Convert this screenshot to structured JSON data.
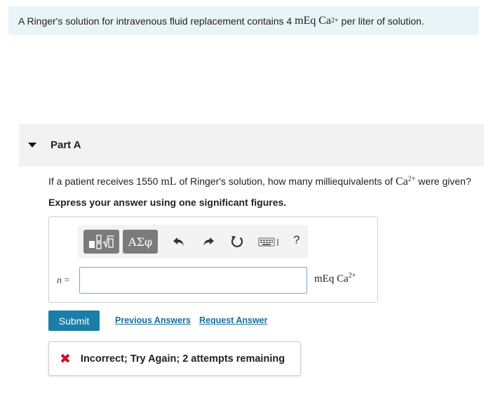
{
  "intro": {
    "text_before": "A Ringer's solution for intravenous fluid replacement contains 4",
    "amount_unit": "mEq",
    "ion": "Ca",
    "charge": "2+",
    "text_after": "per liter of solution."
  },
  "part": {
    "title": "Part A"
  },
  "question": {
    "text_before": "If a patient receives 1550",
    "volume_unit": "mL",
    "text_middle": "of Ringer's solution, how many milliequivalents of",
    "ion": "Ca",
    "charge": "2+",
    "text_after": "were given?",
    "instruction": "Express your answer using one significant figures."
  },
  "toolbar": {
    "templates_icon": "fraction-sqrt-template-icon",
    "greek_label": "ΑΣφ",
    "undo_icon": "undo-icon",
    "redo_icon": "redo-icon",
    "reset_icon": "reset-icon",
    "keyboard_icon": "keyboard-icon",
    "help_label": "?"
  },
  "answer": {
    "variable": "n",
    "equals": "=",
    "value": "",
    "units_amount": "mEq",
    "units_ion": "Ca",
    "units_charge": "2+"
  },
  "actions": {
    "submit_label": "Submit",
    "previous_answers_label": "Previous Answers",
    "request_answer_label": "Request Answer"
  },
  "feedback": {
    "icon": "x-mark-icon",
    "text": "Incorrect; Try Again; 2 attempts remaining",
    "color": "#c8102e"
  },
  "colors": {
    "intro_bg": "#e8f4f6",
    "part_header_bg": "#f2f2f2",
    "submit_bg": "#1a7ea7",
    "link": "#1a6e9e",
    "toolbar_button": "#7b7b7b"
  }
}
